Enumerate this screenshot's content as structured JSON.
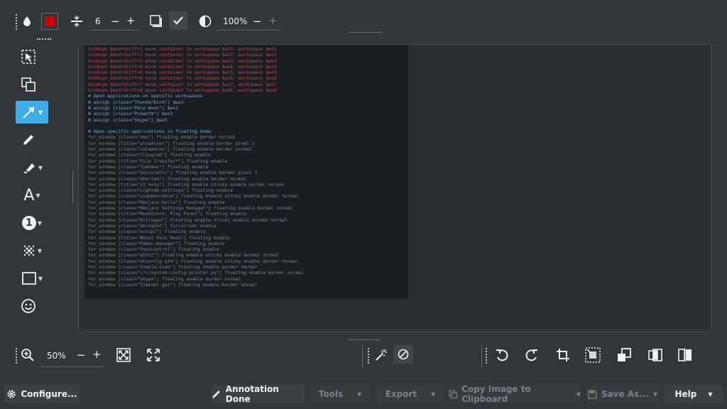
{
  "top_toolbar": {
    "stroke_width": "6",
    "minus": "−",
    "plus": "+",
    "opacity": "100%",
    "opacity_minus": "−",
    "opacity_plus": "+",
    "color_swatch": "#d40000"
  },
  "left_tools": [
    {
      "name": "selection-tool"
    },
    {
      "name": "duplicate-tool"
    },
    {
      "name": "arrow-tool",
      "active": true
    },
    {
      "name": "pen-tool"
    },
    {
      "name": "highlighter-tool"
    },
    {
      "name": "text-tool",
      "glyph": "A"
    },
    {
      "name": "number-tool",
      "glyph": "1"
    },
    {
      "name": "blur-tool"
    },
    {
      "name": "rectangle-tool"
    },
    {
      "name": "sticker-tool"
    }
  ],
  "zoom": {
    "value": "50%",
    "minus": "−",
    "plus": "+"
  },
  "bottom_bar": {
    "configure": "Configure...",
    "annotation_done": "Annotation Done",
    "tools": "Tools",
    "export": "Export",
    "copy_image": "Copy Image to Clipboard",
    "save_as": "Save As...",
    "help": "Help"
  },
  "screenshot_lines": [
    {
      "t": "bindsym $mod+Shift+1 move container to workspace $ws1; workspace $ws1",
      "c": "red"
    },
    {
      "t": "bindsym $mod+Shift+2 move container to workspace $ws2; workspace $ws2",
      "c": "red"
    },
    {
      "t": "bindsym $mod+Shift+3 move container to workspace $ws3; workspace $ws3",
      "c": "red"
    },
    {
      "t": "bindsym $mod+Shift+4 move container to workspace $ws4; workspace $ws4",
      "c": "red"
    },
    {
      "t": "bindsym $mod+Shift+5 move container to workspace $ws5; workspace $ws5",
      "c": "red"
    },
    {
      "t": "bindsym $mod+Shift+6 move container to workspace $ws6; workspace $ws6",
      "c": "red"
    },
    {
      "t": "bindsym $mod+Shift+7 move container to workspace $ws7; workspace $ws7",
      "c": "red"
    },
    {
      "t": "bindsym $mod+Shift+8 move container to workspace $ws8; workspace $ws8",
      "c": "red"
    },
    {
      "t": "# Open applications on specific workspaces",
      "c": "blue"
    },
    {
      "t": "# assign [class=\"Thunderbird\"] $ws1",
      "c": "blue"
    },
    {
      "t": "# assign [class=\"Pale moon\"] $ws2",
      "c": "blue"
    },
    {
      "t": "# assign [class=\"Pcmanfm\"] $ws3",
      "c": "blue"
    },
    {
      "t": "# assign [class=\"Skype\"] $ws5",
      "c": "blue"
    },
    {
      "t": "",
      "c": "grey"
    },
    {
      "t": "# Open specific applications in floating mode",
      "c": "blue"
    },
    {
      "t": "for_window [class=\"obs\"] floating enable border normal",
      "c": "grey"
    },
    {
      "t": "for_window [title=\"alsamixer\"] floating enable border pixel 1",
      "c": "grey"
    },
    {
      "t": "for_window [class=\"calamares\"] floating enable border normal",
      "c": "grey"
    },
    {
      "t": "for_window [class=\"Clipgrab\"] floating enable",
      "c": "grey"
    },
    {
      "t": "for_window [title=\"File Transfer*\"] floating enable",
      "c": "grey"
    },
    {
      "t": "for_window [class=\"fpakman\"] floating enable",
      "c": "grey"
    },
    {
      "t": "for_window [class=\"Galculator\"] floating enable border pixel 1",
      "c": "grey"
    },
    {
      "t": "for_window [class=\"GParted\"] floating enable border normal",
      "c": "grey"
    },
    {
      "t": "for_window [title=\"i3_help\"] floating enable sticky enable border normal",
      "c": "grey"
    },
    {
      "t": "for_window [class=\"Lightdm-settings\"] floating enable",
      "c": "grey"
    },
    {
      "t": "for_window [class=\"Lxappearance\"] floating enable sticky enable border normal",
      "c": "grey"
    },
    {
      "t": "for_window [class=\"Manjaro-hello\"] floating enable",
      "c": "grey"
    },
    {
      "t": "for_window [class=\"Manjaro Settings Manager\"] floating enable border normal",
      "c": "grey"
    },
    {
      "t": "for_window [title=\"MuseScore: Play Panel\"] floating enable",
      "c": "grey"
    },
    {
      "t": "for_window [class=\"Nitrogen\"] floating enable sticky enable border normal",
      "c": "grey"
    },
    {
      "t": "for_window [class=\"Oblogout\"] fullscreen enable",
      "c": "grey"
    },
    {
      "t": "for_window [class=\"octopi\"] floating enable",
      "c": "grey"
    },
    {
      "t": "for_window [title=\"About Pale Moon\"] floating enable",
      "c": "grey"
    },
    {
      "t": "for_window [class=\"Pamac-manager\"] floating enable",
      "c": "grey"
    },
    {
      "t": "for_window [class=\"Pavucontrol\"] floating enable",
      "c": "grey"
    },
    {
      "t": "for_window [class=\"qt5ct\"] floating enable sticky enable border normal",
      "c": "grey"
    },
    {
      "t": "for_window [class=\"Qtconfig-qt4\"] floating enable sticky enable border normal",
      "c": "grey"
    },
    {
      "t": "for_window [class=\"Simple-scan\"] floating enable border normal",
      "c": "grey"
    },
    {
      "t": "for_window [class=\"(?i)System-config-printer.py\"] floating enable border normal",
      "c": "grey"
    },
    {
      "t": "for_window [class=\"Skype\"] floating enable border normal",
      "c": "grey"
    },
    {
      "t": "for_window [class=\"Timeset-gui\"] floating enable border normal",
      "c": "grey"
    }
  ]
}
